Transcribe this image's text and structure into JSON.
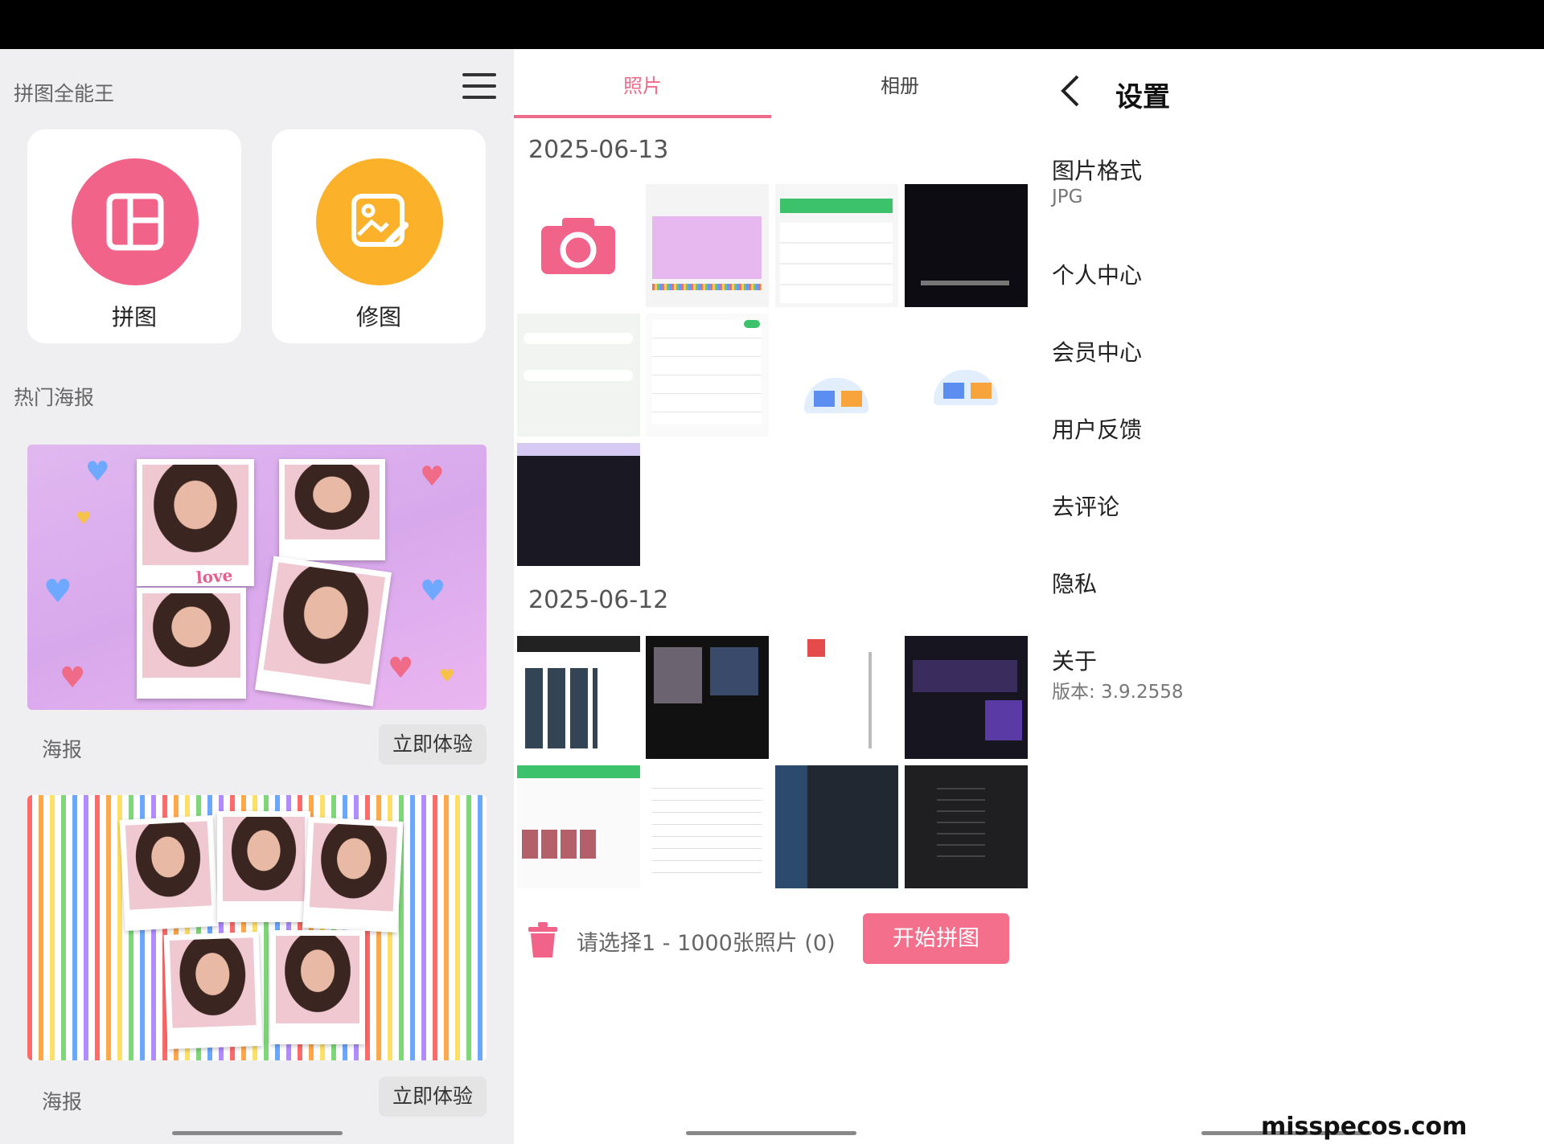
{
  "left_panel": {
    "app_title": "拼图全能王",
    "tools": [
      {
        "label": "拼图",
        "color": "#f2638a"
      },
      {
        "label": "修图",
        "color": "#fbb22a"
      }
    ],
    "section_title": "热门海报",
    "posters": [
      {
        "label": "海报",
        "button": "立即体验",
        "caption": "love"
      },
      {
        "label": "海报",
        "button": "立即体验"
      }
    ]
  },
  "middle_panel": {
    "tabs": [
      {
        "label": "照片",
        "active": true
      },
      {
        "label": "相册",
        "active": false
      }
    ],
    "groups": [
      {
        "date": "2025-06-13"
      },
      {
        "date": "2025-06-12"
      }
    ],
    "bottom": {
      "select_text": "请选择1 - 1000张照片 (0)",
      "start_button": "开始拼图"
    },
    "accent_color": "#f06b88"
  },
  "right_panel": {
    "title": "设置",
    "items": [
      {
        "label": "图片格式",
        "sub": "JPG"
      },
      {
        "label": "个人中心"
      },
      {
        "label": "会员中心"
      },
      {
        "label": "用户反馈"
      },
      {
        "label": "去评论"
      },
      {
        "label": "隐私"
      },
      {
        "label": "关于",
        "sub": "版本: 3.9.2558"
      }
    ]
  },
  "watermark": "misspecos.com"
}
